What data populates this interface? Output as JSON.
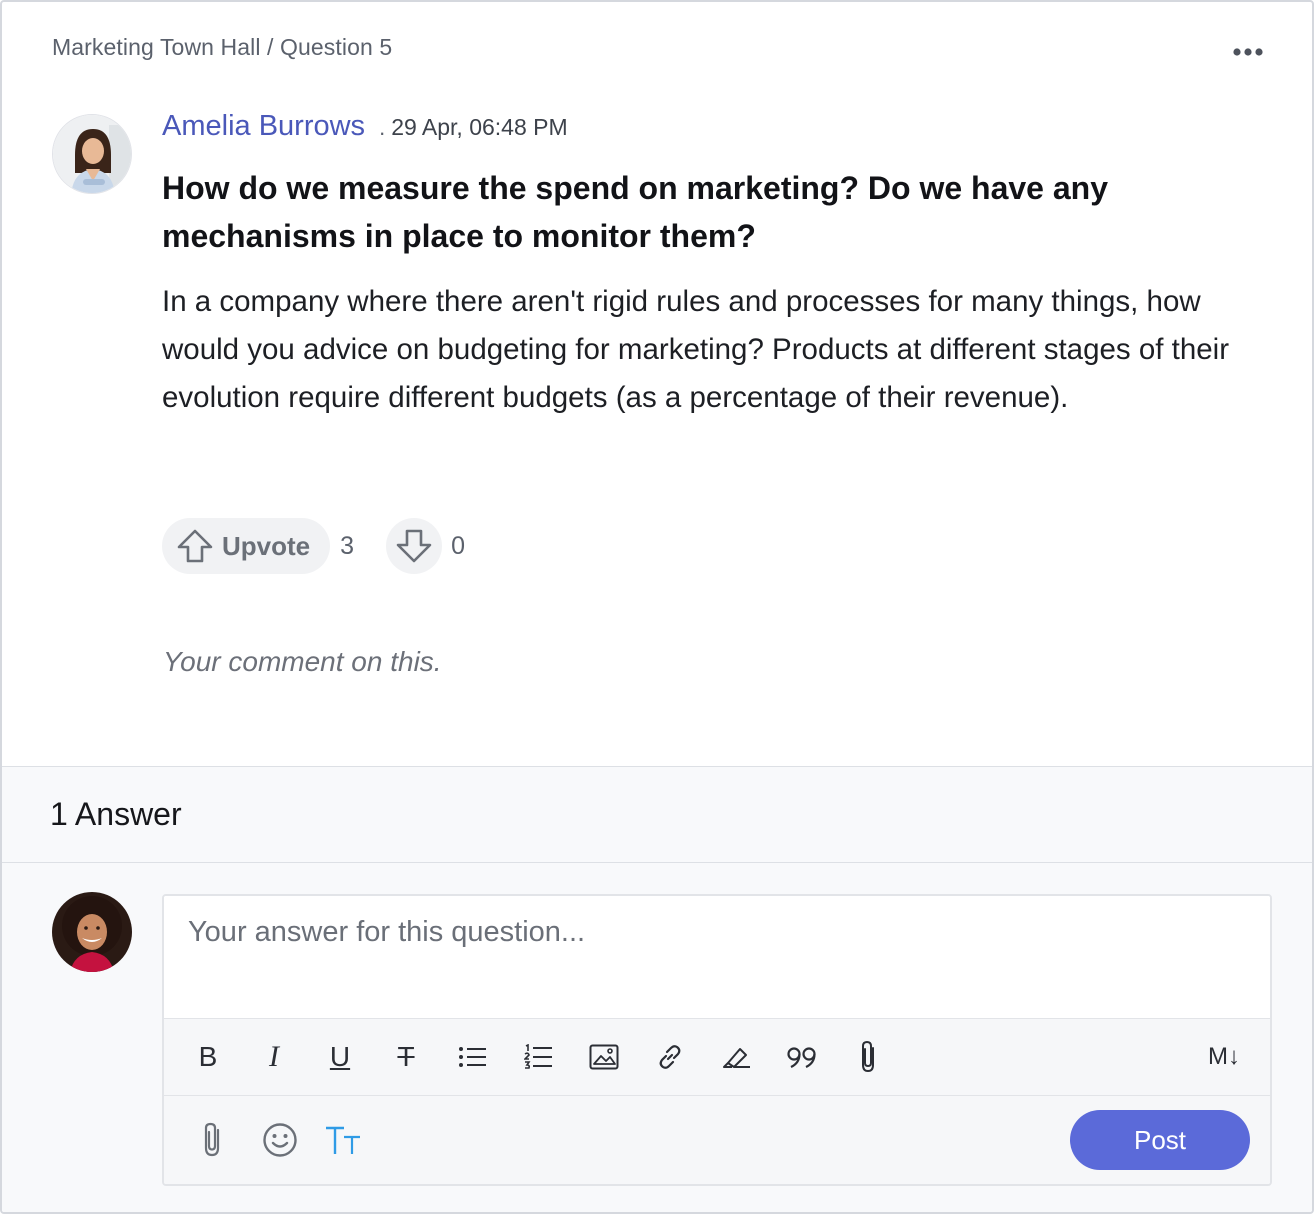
{
  "breadcrumb": "Marketing Town Hall / Question 5",
  "question": {
    "author": "Amelia Burrows",
    "separator": ".",
    "timestamp": "29 Apr, 06:48 PM",
    "title": "How do we measure the spend on marketing? Do we have any mechanisms in place to monitor them?",
    "body": "In a company where there aren't rigid rules and processes for many things, how would you advice on budgeting for marketing? Products at different stages of their evolution require different budgets (as a percentage of their revenue).",
    "upvote_label": "Upvote",
    "upvote_count": "3",
    "downvote_count": "0",
    "comment_placeholder": "Your comment on this."
  },
  "answers": {
    "count_label": "1 Answer"
  },
  "editor": {
    "placeholder": "Your answer for this question...",
    "toolbar": {
      "bold": "B",
      "italic": "I",
      "underline": "U",
      "strikethrough": "T",
      "markdown": "M↓"
    },
    "text_size_label": "TT",
    "post_label": "Post"
  },
  "icons": [
    "more-options-icon",
    "upvote-icon",
    "downvote-icon",
    "bulleted-list-icon",
    "numbered-list-icon",
    "image-icon",
    "link-icon",
    "highlighter-icon",
    "quote-icon",
    "attachment-icon",
    "emoji-icon",
    "text-size-icon"
  ],
  "colors": {
    "accent": "#5b6ad9",
    "author_link": "#4a58b9",
    "text_size_icon": "#2f9be6"
  }
}
